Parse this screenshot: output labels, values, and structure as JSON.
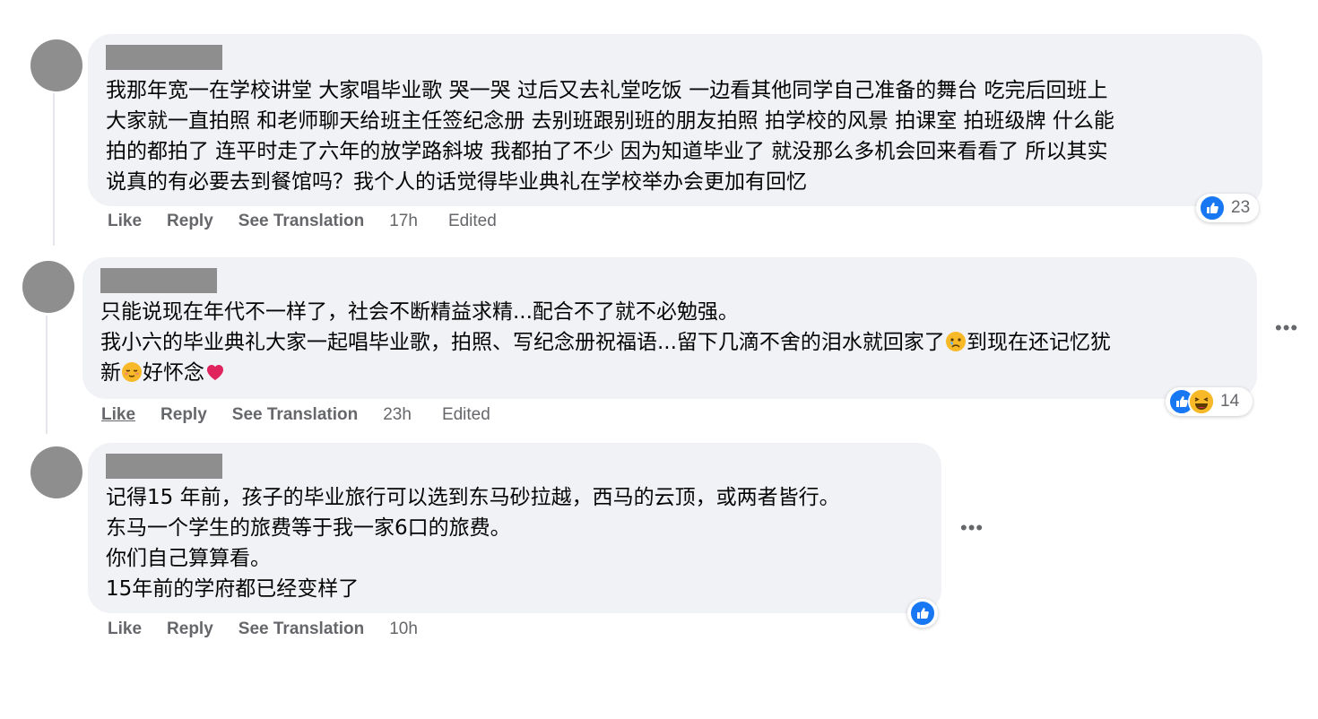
{
  "comments": [
    {
      "lines": [
        "我那年宽一在学校讲堂 大家唱毕业歌 哭一哭 过后又去礼堂吃饭 一边看其他同学自己准备的舞台 吃完后回班上",
        "大家就一直拍照 和老师聊天给班主任签纪念册 去别班跟别班的朋友拍照 拍学校的风景 拍课室 拍班级牌 什么能",
        "拍的都拍了 连平时走了六年的放学路斜坡 我都拍了不少 因为知道毕业了 就没那么多机会回来看看了 所以其实",
        "说真的有必要去到餐馆吗？我个人的话觉得毕业典礼在学校举办会更加有回忆"
      ],
      "actions": {
        "like": "Like",
        "reply": "Reply",
        "translate": "See Translation",
        "time": "17h",
        "edited": "Edited"
      },
      "reaction_count": "23"
    },
    {
      "lines": [
        "只能说现在年代不一样了，社会不断精益求精...配合不了就不必勉强。",
        "我小六的毕业典礼大家一起唱毕业歌，拍照、写纪念册祝福语...留下几滴不舍的泪水就回家了",
        "到现在还记忆犹",
        "新",
        "好怀念"
      ],
      "actions": {
        "like": "Like",
        "reply": "Reply",
        "translate": "See Translation",
        "time": "23h",
        "edited": "Edited"
      },
      "reaction_count": "14",
      "more": "•••"
    },
    {
      "lines": [
        "记得15 年前，孩子的毕业旅行可以选到东马砂拉越，西马的云顶，或两者皆行。",
        "东马一个学生的旅费等于我一家6口的旅费。",
        "你们自己算算看。",
        "15年前的学府都已经变样了"
      ],
      "actions": {
        "like": "Like",
        "reply": "Reply",
        "translate": "See Translation",
        "time": "10h"
      },
      "more": "•••"
    }
  ],
  "colors": {
    "bubble": "#f0f2f5",
    "like_blue": "#1877f2",
    "meta_gray": "#65676b"
  }
}
